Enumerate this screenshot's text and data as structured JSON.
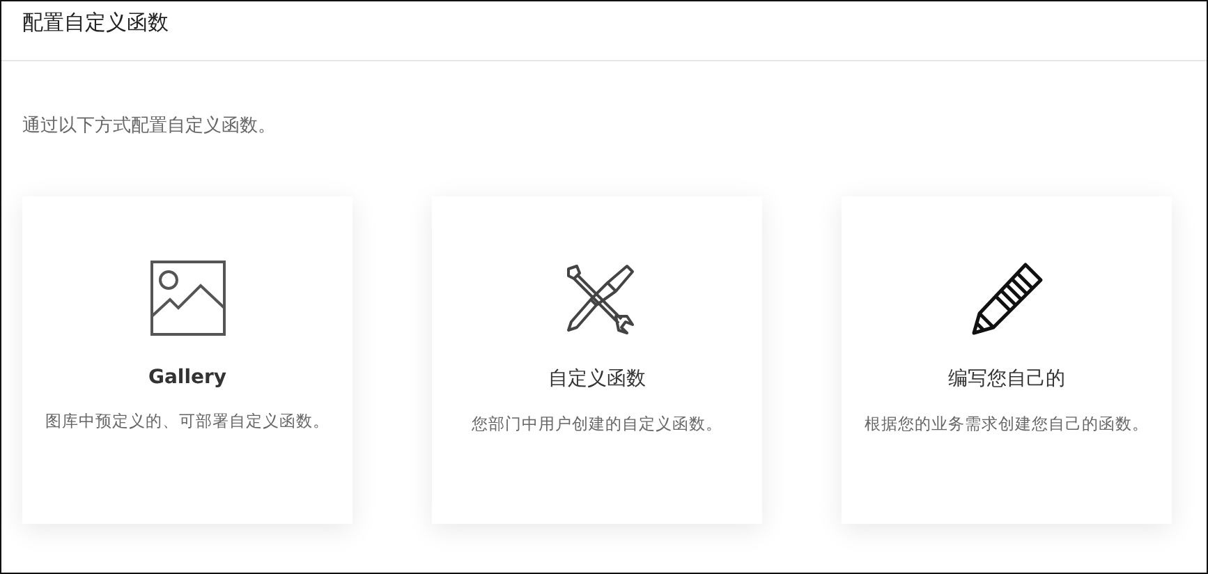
{
  "header": {
    "title": "配置自定义函数"
  },
  "intro": "通过以下方式配置自定义函数。",
  "cards": [
    {
      "kind": "gallery",
      "title": "Gallery",
      "description": "图库中预定义的、可部署自定义函数。"
    },
    {
      "kind": "tools",
      "title": "自定义函数",
      "description": "您部门中用户创建的自定义函数。"
    },
    {
      "kind": "pencil",
      "title": "编写您自己的",
      "description": "根据您的业务需求创建您自己的函数。"
    }
  ]
}
